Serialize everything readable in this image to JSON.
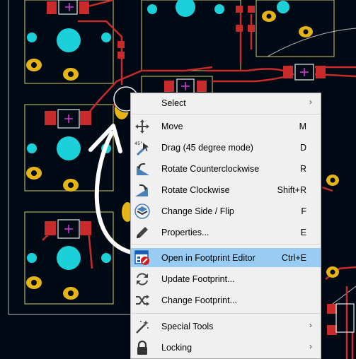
{
  "colors": {
    "board": "#000a14",
    "pad": "#e7b416",
    "copper": "#c92b2b",
    "via": "#1bd0d8",
    "silk": "#ecd870",
    "menu_bg": "#f0f0f0",
    "highlight": "#99ccf3"
  },
  "menu": {
    "items": [
      {
        "label": "Select",
        "shortcut": "",
        "submenu": true,
        "icon": "none"
      },
      {
        "label": "Move",
        "shortcut": "M",
        "submenu": false,
        "icon": "move-icon"
      },
      {
        "label": "Drag (45 degree mode)",
        "shortcut": "D",
        "submenu": false,
        "icon": "drag-45-icon",
        "badge": "45°"
      },
      {
        "label": "Rotate Counterclockwise",
        "shortcut": "R",
        "submenu": false,
        "icon": "rotate-ccw-icon"
      },
      {
        "label": "Rotate Clockwise",
        "shortcut": "Shift+R",
        "submenu": false,
        "icon": "rotate-cw-icon"
      },
      {
        "label": "Change Side / Flip",
        "shortcut": "F",
        "submenu": false,
        "icon": "flip-icon"
      },
      {
        "label": "Properties...",
        "shortcut": "E",
        "submenu": false,
        "icon": "pencil-icon"
      },
      {
        "label": "Open in Footprint Editor",
        "shortcut": "Ctrl+E",
        "submenu": false,
        "icon": "footprint-editor-icon",
        "highlighted": true
      },
      {
        "label": "Update Footprint...",
        "shortcut": "",
        "submenu": false,
        "icon": "refresh-icon"
      },
      {
        "label": "Change Footprint...",
        "shortcut": "",
        "submenu": false,
        "icon": "shuffle-icon"
      },
      {
        "label": "Special Tools",
        "shortcut": "",
        "submenu": true,
        "icon": "magic-wand-icon"
      },
      {
        "label": "Locking",
        "shortcut": "",
        "submenu": true,
        "icon": "lock-icon"
      }
    ],
    "submenu_arrow": "›"
  }
}
